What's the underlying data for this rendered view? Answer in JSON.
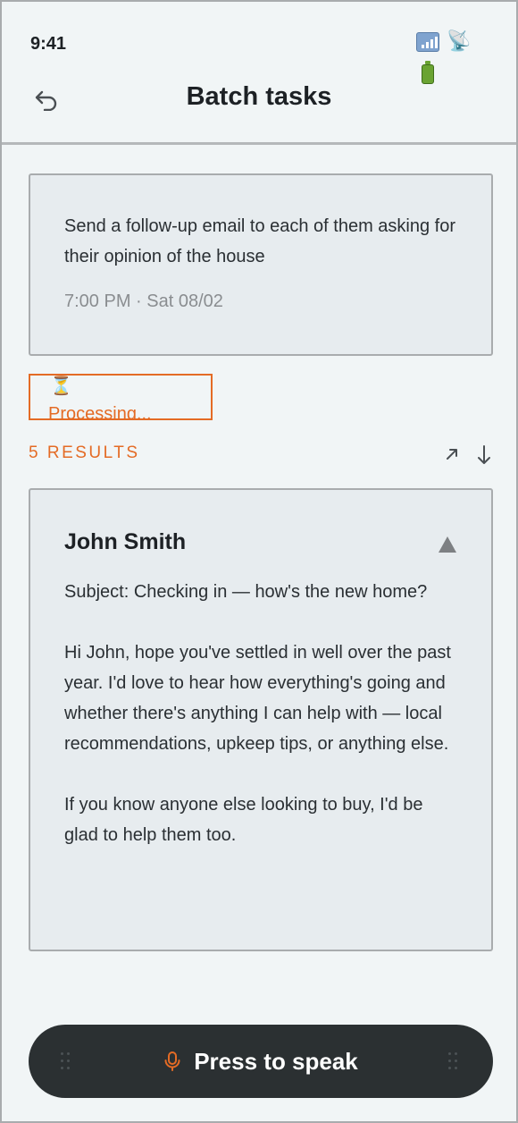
{
  "status": {
    "time": "9:41",
    "icons": [
      "signal-icon",
      "satellite-icon",
      "battery-icon"
    ]
  },
  "header": {
    "title": "Batch tasks",
    "back_icon": "undo-arrow-icon"
  },
  "prompt": {
    "text": "Send a follow-up email to each of them asking for their opinion of the house",
    "meta": "7:00 PM · Sat 08/02"
  },
  "processing": {
    "icon": "hourglass-icon",
    "label": "Processing..."
  },
  "results": {
    "count_label": "5 RESULTS",
    "actions": [
      "expand-arrow-icon",
      "download-arrow-icon"
    ]
  },
  "result_items": [
    {
      "name": "John Smith",
      "subject": "Subject: Checking in — how's the new home?",
      "paragraphs": [
        "Hi John, hope you've settled in well over the past year. I'd love to hear how everything's going and whether there's anything I can help with — local recommendations, upkeep tips, or anything else.",
        "If you know anyone else looking to buy, I'd be glad to help them too."
      ]
    }
  ],
  "speak_button": {
    "label": "Press to speak",
    "icon": "microphone-icon"
  },
  "colors": {
    "accent": "#e46b25",
    "background": "#f1f5f6",
    "card": "#e7ecef",
    "dark_button": "#2b3032"
  }
}
